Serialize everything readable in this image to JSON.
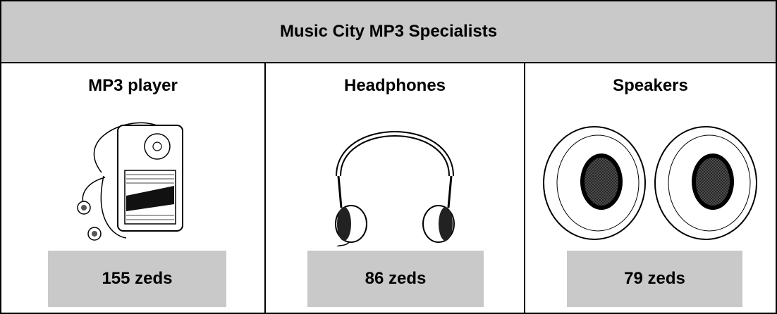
{
  "header": {
    "title": "Music City MP3 Specialists"
  },
  "products": [
    {
      "name": "MP3 player",
      "price": "155 zeds",
      "icon": "mp3-player-icon"
    },
    {
      "name": "Headphones",
      "price": "86 zeds",
      "icon": "headphones-icon"
    },
    {
      "name": "Speakers",
      "price": "79 zeds",
      "icon": "speakers-icon"
    }
  ]
}
